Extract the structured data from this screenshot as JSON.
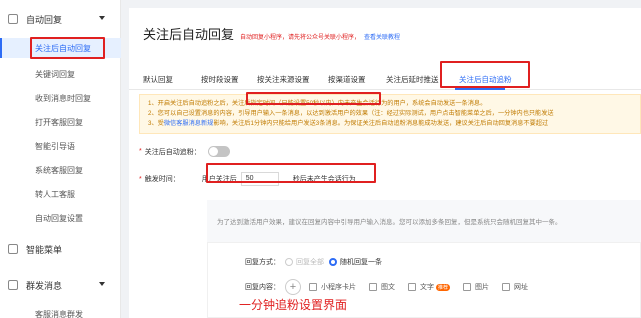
{
  "sidebar": {
    "group1_label": "自动回复",
    "items": [
      {
        "label": "关注后自动回复"
      },
      {
        "label": "关键词回复"
      },
      {
        "label": "收到消息时回复"
      },
      {
        "label": "打开客服回复"
      },
      {
        "label": "智能引导语"
      },
      {
        "label": "系统客服回复"
      },
      {
        "label": "转人工客服"
      },
      {
        "label": "自动回复设置"
      }
    ],
    "group2_label": "智能菜单",
    "group3_label": "群发消息",
    "group3_item": "客服消息群发"
  },
  "header": {
    "title": "关注后自动回复",
    "hint": "自动回复小程序，请先将公众号关联小程序，",
    "link": "查看关联教程"
  },
  "tabs": [
    {
      "label": "默认回复"
    },
    {
      "label": "按时段设置"
    },
    {
      "label": "按关注来源设置"
    },
    {
      "label": "按渠道设置"
    },
    {
      "label": "关注后延时推送"
    },
    {
      "label": "关注后自动追粉"
    }
  ],
  "notice": {
    "line1_a": "1、开启关注后自动追粉之后，",
    "line1_b": "关注后指定时间（只能设置50秒以内）",
    "line1_c": "内未产生会话行为的用户，系统会自动发送一条消息。",
    "line2": "2、您可以自己设置消息的内容，引导用户输入一条消息，以达到激活用户的效果（注：经过实际测试，用户点击智能菜单之后，一分钟内也只能发送",
    "line3_a": "3、受",
    "line3_link": "微信客服消息新规",
    "line3_b": "影响，关注后1分钟内只能给用户发送3条消息。为保证关注后自动追粉消息能成功发送，建议关注后自动回复消息不要超过"
  },
  "form": {
    "toggle_label": "关注后自动追粉：",
    "toggle_on": false,
    "trigger_label": "触发时间：",
    "trigger_prefix": "用户关注后",
    "trigger_value": "50",
    "trigger_suffix": "秒后未产生会话行为"
  },
  "reply": {
    "tip": "为了达到激活用户效果，建议在回复内容中引导用户输入消息。您可以添加多条回复，但是系统只会随机回复其中一条。",
    "mode_label": "回复方式：",
    "mode_option_all": "回复全部",
    "mode_option_random": "随机回复一条",
    "content_label": "回复内容：",
    "tools": [
      "小程序卡片",
      "图文",
      "文字",
      "图片",
      "网址"
    ],
    "text_badge": "推荐"
  },
  "caption": "一分钟追粉设置界面",
  "colors": {
    "accent": "#2d6cf5",
    "highlight_red": "#e02020"
  }
}
